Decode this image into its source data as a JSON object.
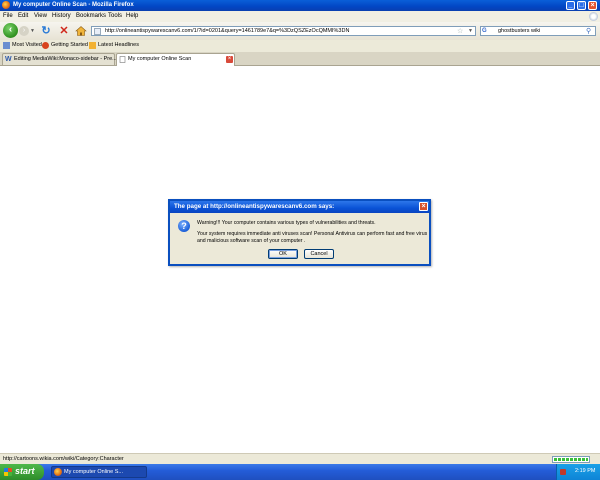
{
  "window": {
    "title": "My computer Online Scan - Mozilla Firefox"
  },
  "menu": [
    "File",
    "Edit",
    "View",
    "History",
    "Bookmarks",
    "Tools",
    "Help"
  ],
  "navigation": {
    "url": "http://onlineantispywarescanv6.com/1/?id=0201&query=1461789e7&q=%3DzQSZEzOcQMMI%3DN",
    "search_engine_icon": "google-icon",
    "search_query": "ghostbusters wiki"
  },
  "bookmarks": [
    "Most Visited",
    "Getting Started",
    "Latest Headlines"
  ],
  "tabs": [
    {
      "label": "Editing MediaWiki:Monaco-sidebar - Pre...",
      "active": false
    },
    {
      "label": "My computer Online Scan",
      "active": true
    }
  ],
  "dialog": {
    "title": "The page at http://onlineantispywarescanv6.com says:",
    "line1": "Warning!!! Your computer contains various types of vulnerabilities and threats.",
    "line2": "Your system requires immediate anti viruses scan! Personal Antivirus can perform fast and free virus",
    "line3": "and malicious software scan of your computer .",
    "ok_label": "OK",
    "cancel_label": "Cancel"
  },
  "status": {
    "text": "http://cartoons.wikia.com/wiki/Category:Character",
    "progress": 1.0
  },
  "taskbar": {
    "start_label": "start",
    "item_label": "My computer Online S...",
    "clock": "2:19 PM"
  },
  "colors": {
    "titlebar": "#0246c4",
    "dialog_border": "#0a4fbf",
    "start_button": "#2e8d2a",
    "taskbar": "#245dd8"
  }
}
